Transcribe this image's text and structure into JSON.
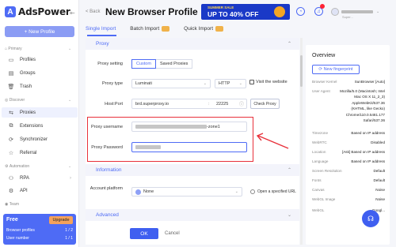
{
  "app": {
    "logo_letter": "A",
    "logo_text": "AdsPower"
  },
  "sidebar": {
    "new_profile": "+ New Profile",
    "primary_label": "Primary",
    "discover_label": "Discover",
    "automation_label": "Automation",
    "team_label": "Team",
    "items": [
      {
        "label": "Profiles",
        "icon": "folder-icon"
      },
      {
        "label": "Groups",
        "icon": "group-icon"
      },
      {
        "label": "Trash",
        "icon": "trash-icon"
      },
      {
        "label": "Proxies",
        "icon": "proxy-icon"
      },
      {
        "label": "Extensions",
        "icon": "extension-icon"
      },
      {
        "label": "Synchronizer",
        "icon": "sync-icon"
      },
      {
        "label": "Referral",
        "icon": "star-icon"
      },
      {
        "label": "RPA",
        "icon": "rpa-icon"
      },
      {
        "label": "API",
        "icon": "api-icon"
      }
    ],
    "plan": {
      "name": "Free",
      "upgrade": "Upgrade",
      "profiles_label": "Browser profiles",
      "profiles_value": "1 / 2",
      "users_label": "User number",
      "users_value": "1 / 1"
    }
  },
  "header": {
    "back": "< Back",
    "title": "New Browser Profile",
    "banner_line1": "SUMMER SALE",
    "banner_line2": "UP TO 40% OFF",
    "user_sub": "Super..."
  },
  "tabs": [
    "Single Import",
    "Batch Import",
    "Quick Import"
  ],
  "form": {
    "proxy_section": "Proxy",
    "proxy_setting_label": "Proxy setting",
    "custom": "Custom",
    "saved_proxies": "Saved Proxies",
    "proxy_type_label": "Proxy type",
    "proxy_type_value": "Luminati",
    "protocol_value": "HTTP",
    "visit_website": "Visit the website",
    "host_label": "Host:Port",
    "host_value": "brd.superproxy.io",
    "port_separator": ":",
    "port_value": "22225",
    "check_proxy": "Check Proxy",
    "username_label": "Proxy username",
    "username_suffix": "-zone1",
    "password_label": "Proxy Password",
    "information_section": "Information",
    "account_platform_label": "Account platform",
    "account_platform_value": "None",
    "open_specified_url": "Open a specified URL",
    "advanced_section": "Advanced"
  },
  "footer": {
    "ok": "OK",
    "cancel": "Cancel"
  },
  "overview": {
    "title": "Overview",
    "new_fingerprint": "New fingerprint",
    "rows": [
      {
        "k": "Browser Kernel",
        "v": "SunBrowser [Auto]"
      },
      {
        "k": "User Agent",
        "v": ""
      },
      {
        "k": "Timezone",
        "v": "Based on IP address"
      },
      {
        "k": "WebRTC",
        "v": "Disabled"
      },
      {
        "k": "Location",
        "v": "[Ask] Based on IP address"
      },
      {
        "k": "Language",
        "v": "Based on IP address"
      },
      {
        "k": "Screen Resolution",
        "v": "Default"
      },
      {
        "k": "Fonts",
        "v": "Default"
      },
      {
        "k": "Canvas",
        "v": "Noise"
      },
      {
        "k": "WebGL Image",
        "v": "Noise"
      },
      {
        "k": "WebGL",
        "v": "Googl..."
      }
    ],
    "ua_lines": [
      "Mozilla/5.0 (Macintosh; Intel",
      "Mac OS X 11_2_3)",
      "AppleWebKit/537.36",
      "(KHTML, like Gecko)",
      "Chrome/110.0.5481.177",
      "Safari/537.36"
    ]
  },
  "colors": {
    "accent": "#4e6bf5",
    "highlight": "#e8303a",
    "plan_bg": "#4e6bf5",
    "upgrade": "#f4a25b"
  }
}
